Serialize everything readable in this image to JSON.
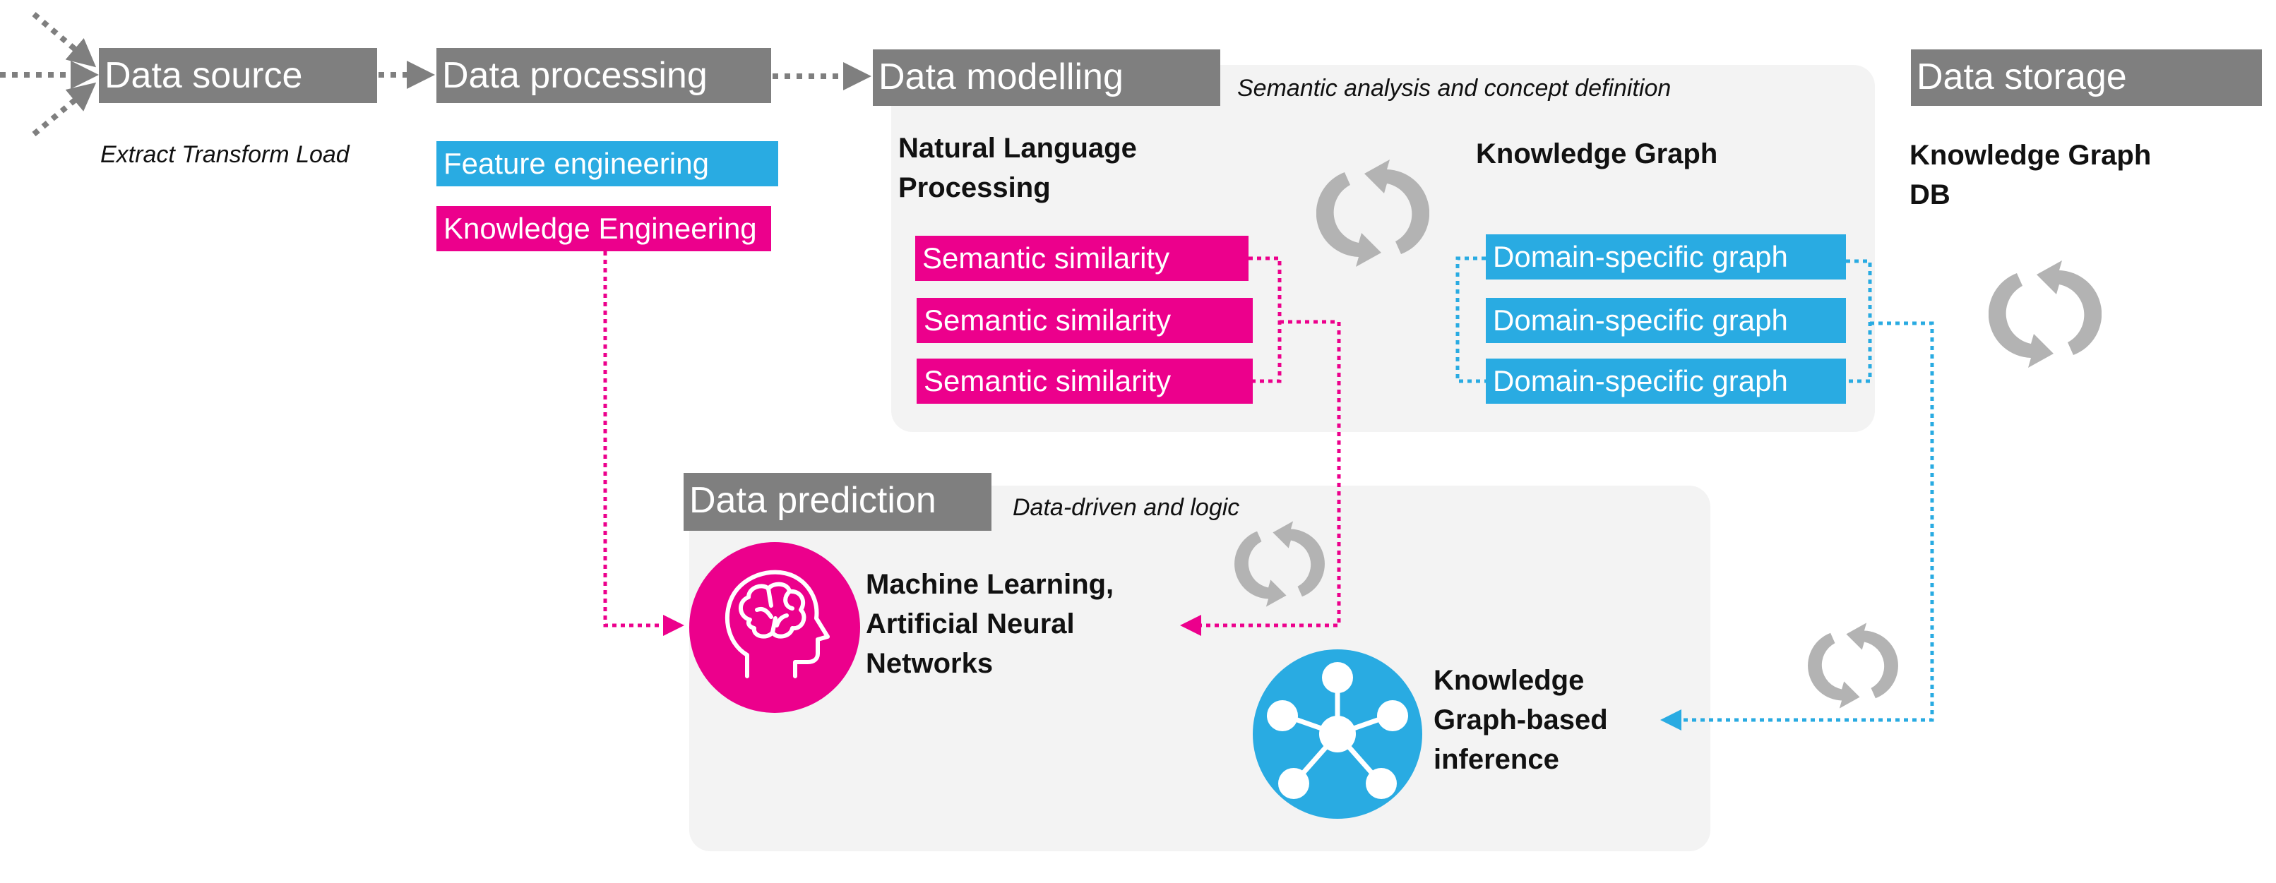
{
  "colors": {
    "header_bg": "#7f7f7f",
    "panel_bg": "#f3f3f3",
    "pink": "#ec008c",
    "blue": "#29abe2",
    "cycle_gray": "#b3b3b3"
  },
  "stages": {
    "source": {
      "title": "Data source",
      "subtitle": "Extract Transform Load"
    },
    "processing": {
      "title": "Data processing",
      "tags": [
        "Feature engineering",
        "Knowledge Engineering"
      ]
    },
    "modelling": {
      "title": "Data modelling",
      "subtitle": "Semantic analysis and concept definition",
      "nlp": {
        "label_line1": "Natural Language",
        "label_line2": "Processing",
        "tags": [
          "Semantic similarity",
          "Semantic similarity",
          "Semantic similarity"
        ]
      },
      "kg": {
        "label": "Knowledge Graph",
        "tags": [
          "Domain-specific graph",
          "Domain-specific graph",
          "Domain-specific graph"
        ]
      }
    },
    "storage": {
      "title": "Data storage",
      "label_line1": "Knowledge Graph",
      "label_line2": "DB"
    },
    "prediction": {
      "title": "Data prediction",
      "subtitle": "Data-driven and logic",
      "ml": {
        "line1": "Machine Learning,",
        "line2": "Artificial Neural",
        "line3": "Networks",
        "icon": "brain-head-icon"
      },
      "kgi": {
        "line1": "Knowledge",
        "line2": "Graph-based",
        "line3": "inference",
        "icon": "graph-network-icon"
      }
    }
  },
  "icons": [
    "cycle-arrows-icon",
    "brain-head-icon",
    "graph-network-icon"
  ]
}
